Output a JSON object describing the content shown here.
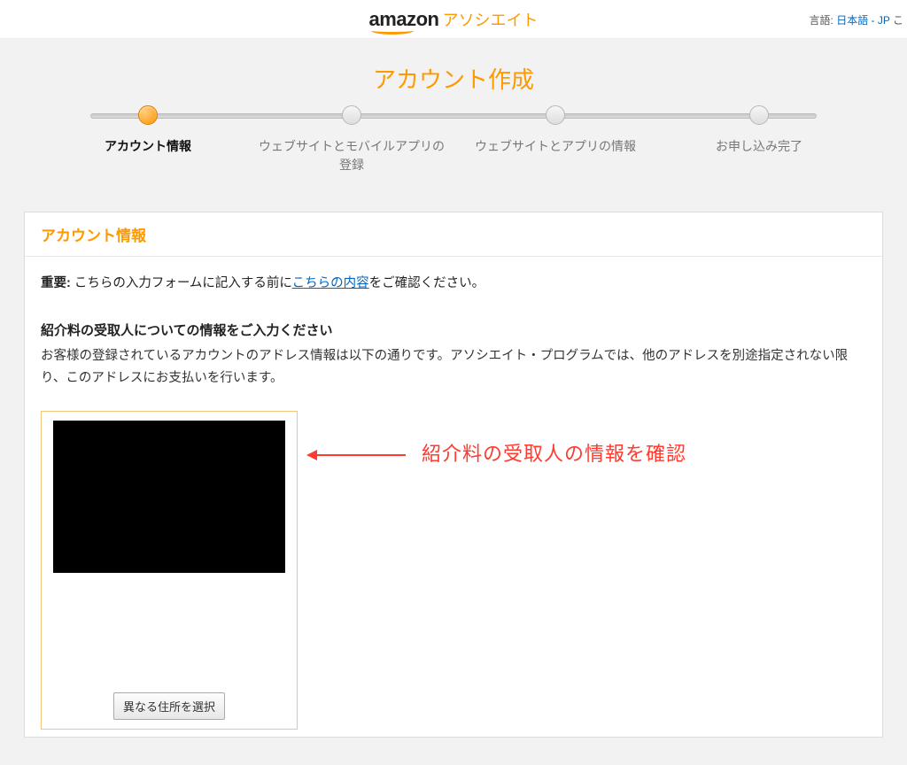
{
  "header": {
    "logo_main": "amazon",
    "logo_sub": "アソシエイト",
    "lang_label": "言語:",
    "lang_value": "日本語 - JP",
    "lang_chevron": "こ"
  },
  "page_title": "アカウント作成",
  "steps": [
    {
      "label": "アカウント情報",
      "active": true
    },
    {
      "label": "ウェブサイトとモバイルアプリの登録",
      "active": false
    },
    {
      "label": "ウェブサイトとアプリの情報",
      "active": false
    },
    {
      "label": "お申し込み完了",
      "active": false
    }
  ],
  "card": {
    "title": "アカウント情報",
    "important_label": "重要:",
    "important_pre": " こちらの入力フォームに記入する前に",
    "important_link": "こちらの内容",
    "important_post": "をご確認ください。",
    "sub_title": "紹介料の受取人についての情報をご入力ください",
    "sub_desc": "お客様の登録されているアカウントのアドレス情報は以下の通りです。アソシエイト・プログラムでは、他のアドレスを別途指定されない限り、このアドレスにお支払いを行います。",
    "choose_button": "異なる住所を選択"
  },
  "annotation": "紹介料の受取人の情報を確認"
}
